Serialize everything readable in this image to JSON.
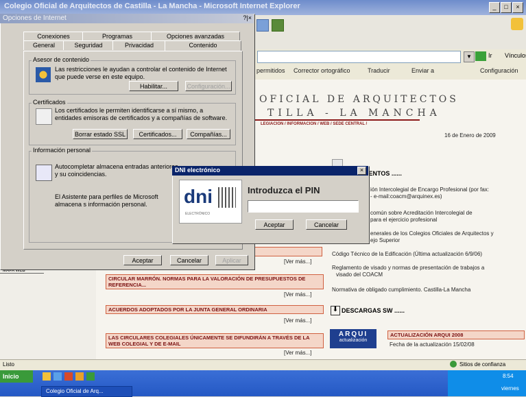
{
  "browser": {
    "title": "Colegio Oficial de Arquitectos de Castilla - La Mancha - Microsoft Internet Explorer",
    "goto_label": "Ir",
    "links_label": "Vínculos",
    "toolbar": {
      "permitidos": "permitidos",
      "corrector": "Corrector ortográfico",
      "traducir": "Traducir",
      "enviar": "Enviar a",
      "configuracion": "Configuración"
    },
    "status": {
      "left": "Listo",
      "zone": "Sitios de confianza"
    }
  },
  "page": {
    "logo_line1": "OFICIAL DE ARQUITECTOS",
    "logo_line2": "TILLA - LA MANCHA",
    "nav": "LEGIACION / INFORMACION / WEB / SEDE CENTRAL /",
    "date": "16 de Enero de 2009",
    "docs_title": "MENTOS ......",
    "doc_items": [
      "ión Intercolegial de Encargo Profesional (por fax:",
      "- e-mail:coacm@arquinex.es)",
      "común sobre Acreditación Intercolegial de",
      "para el ejercicio profesional",
      "enerales de los Colegios Oficiales de Arquitectos y",
      "ejo Superior",
      "Código Técnico de la Edificación (Última actualización 6/9/06)",
      "Reglamento de visado y normas de presentación de trabajos a",
      "visado del COACM",
      "Normativa de obligado cumplimiento. Castilla-La Mancha"
    ],
    "descargas": "DESCARGAS SW ......",
    "arqui_title": "ARQUI",
    "arqui_sub": "actualización",
    "arqui_update": "ACTUALIZACIÓN ARQUI 2008",
    "arqui_date": "Fecha de la actualización 15/02/08",
    "mapa_web": "MAPA WEB",
    "news": [
      {
        "title": "CIRCULAR MARRÓN. NORMAS PARA LA VALORACIÓN DE PRESUPUESTOS DE REFERENCIA...",
        "more": "[Ver más...]"
      },
      {
        "title": "ACUERDOS ADOPTADOS POR LA JUNTA GENERAL ORDINARIA",
        "more": "[Ver más...]"
      },
      {
        "title": "LAS CIRCULARES COLEGIALES ÚNICAMENTE SE DIFUNDIRÁN A TRAVÉS DE LA WEB COLEGIAL Y DE E-MAIL",
        "more": "[Ver más...]"
      }
    ],
    "more_top": "[Ver más...]"
  },
  "internet_options": {
    "title": "Opciones de Internet",
    "tabs_row1": [
      "Conexiones",
      "Programas",
      "Opciones avanzadas"
    ],
    "tabs_row2": [
      "General",
      "Seguridad",
      "Privacidad",
      "Contenido"
    ],
    "asesor": {
      "label": "Asesor de contenido",
      "text": "Las restricciones le ayudan a controlar el contenido de Internet que puede verse en este equipo.",
      "enable": "Habilitar...",
      "config": "Configuración..."
    },
    "certs": {
      "label": "Certificados",
      "text": "Los certificados le permiten identificarse a sí mismo, a entidades emisoras de certificados y a compañías de software.",
      "clear_ssl": "Borrar estado SSL",
      "certificates": "Certificados...",
      "publishers": "Compañías..."
    },
    "personal": {
      "label": "Información personal",
      "autocomplete": "Autocompletar almacena entradas anteriores y su coincidencias.",
      "profile": "El Asistente para perfiles de Microsoft almacena s información personal."
    },
    "ok": "Aceptar",
    "cancel": "Cancelar",
    "apply": "Aplicar"
  },
  "dni_dialog": {
    "title": "DNI electrónico",
    "logo_text": "dni",
    "logo_sub": "ELECTRÓNICO",
    "prompt": "Introduzca el PIN",
    "pin_value": "",
    "ok": "Aceptar",
    "cancel": "Cancelar"
  },
  "taskbar": {
    "start": "Inicio",
    "window_item": "Colegio Oficial de Arq...",
    "clock": "8:54",
    "day": "viernes"
  }
}
